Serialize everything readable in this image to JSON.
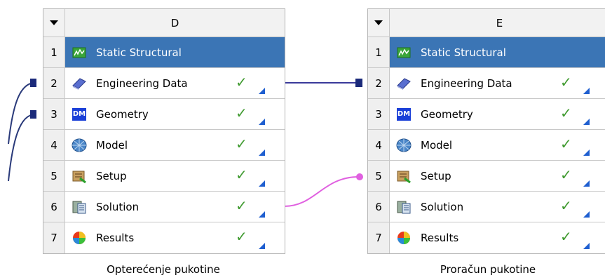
{
  "systems": [
    {
      "id": "D",
      "header": "D",
      "caption": "Opterećenje pukotine",
      "rows": [
        {
          "index": "1",
          "label": "Static Structural",
          "icon": "static-structural-icon",
          "status": ""
        },
        {
          "index": "2",
          "label": "Engineering Data",
          "icon": "engineering-data-icon",
          "status": "up-to-date"
        },
        {
          "index": "3",
          "label": "Geometry",
          "icon": "geometry-dm-icon",
          "status": "up-to-date"
        },
        {
          "index": "4",
          "label": "Model",
          "icon": "model-icon",
          "status": "up-to-date"
        },
        {
          "index": "5",
          "label": "Setup",
          "icon": "setup-icon",
          "status": "up-to-date"
        },
        {
          "index": "6",
          "label": "Solution",
          "icon": "solution-icon",
          "status": "up-to-date"
        },
        {
          "index": "7",
          "label": "Results",
          "icon": "results-icon",
          "status": "up-to-date"
        }
      ]
    },
    {
      "id": "E",
      "header": "E",
      "caption": "Proračun pukotine",
      "rows": [
        {
          "index": "1",
          "label": "Static Structural",
          "icon": "static-structural-icon",
          "status": ""
        },
        {
          "index": "2",
          "label": "Engineering Data",
          "icon": "engineering-data-icon",
          "status": "up-to-date"
        },
        {
          "index": "3",
          "label": "Geometry",
          "icon": "geometry-dm-icon",
          "status": "up-to-date"
        },
        {
          "index": "4",
          "label": "Model",
          "icon": "model-icon",
          "status": "up-to-date"
        },
        {
          "index": "5",
          "label": "Setup",
          "icon": "setup-icon",
          "status": "up-to-date"
        },
        {
          "index": "6",
          "label": "Solution",
          "icon": "solution-icon",
          "status": "up-to-date"
        },
        {
          "index": "7",
          "label": "Results",
          "icon": "results-icon",
          "status": "up-to-date"
        }
      ]
    }
  ],
  "geometry_badge": "DM",
  "colors": {
    "title_bg": "#3b75b5",
    "check": "#3f9a2f",
    "link_shared": "#3a3a9a",
    "link_transfer": "#e060e0",
    "corner": "#1f5fd0"
  }
}
